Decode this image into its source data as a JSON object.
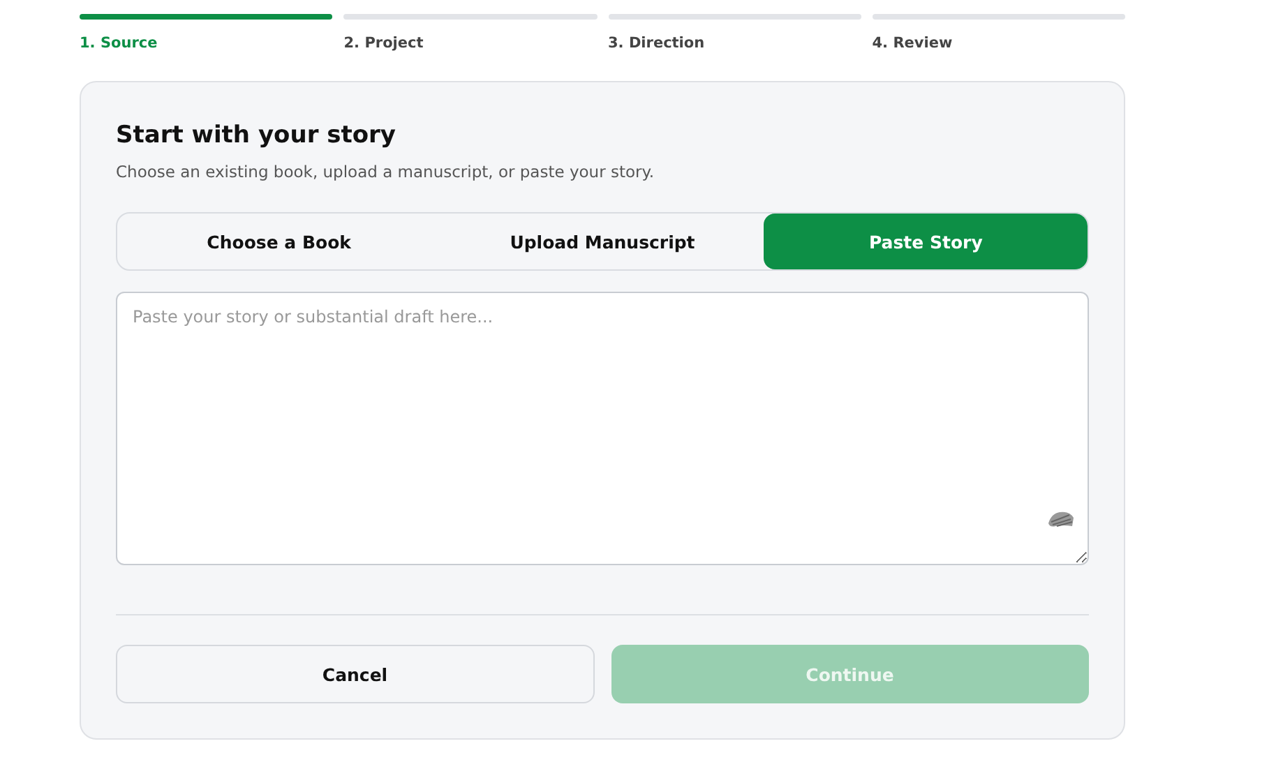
{
  "steps": [
    {
      "label": "1. Source",
      "selected": true
    },
    {
      "label": "2. Project",
      "selected": false
    },
    {
      "label": "3. Direction",
      "selected": false
    },
    {
      "label": "4. Review",
      "selected": false
    }
  ],
  "card": {
    "title": "Start with your story",
    "subtitle": "Choose an existing book, upload a manuscript, or paste your story.",
    "tabs": [
      {
        "label": "Choose a Book",
        "selected": false
      },
      {
        "label": "Upload Manuscript",
        "selected": false
      },
      {
        "label": "Paste Story",
        "selected": true
      }
    ],
    "story": {
      "placeholder": "Paste your story or substantial draft here..."
    },
    "buttons": [
      {
        "label": "Cancel",
        "kind": "secondary",
        "disabled": false
      },
      {
        "label": "Continue",
        "kind": "primary",
        "disabled": true
      }
    ]
  }
}
